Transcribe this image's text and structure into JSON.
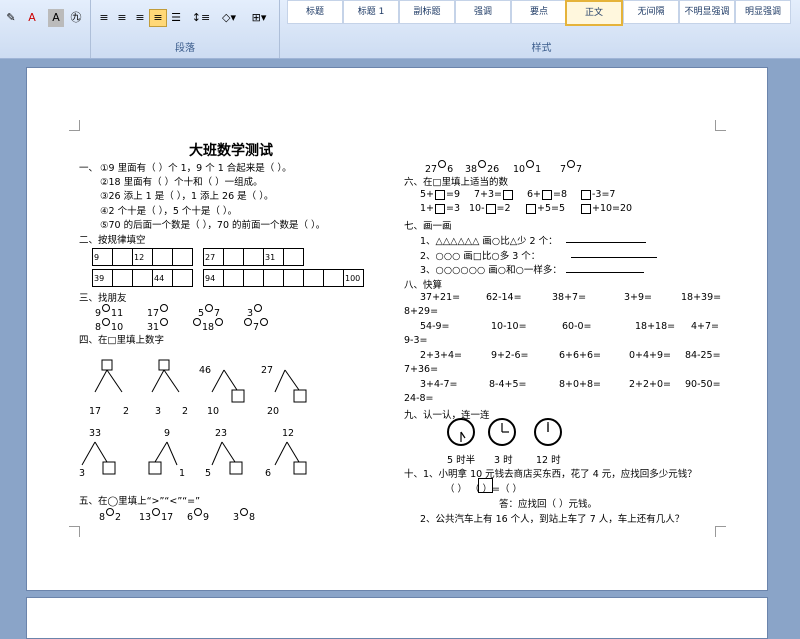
{
  "ribbon": {
    "paragraph_label": "段落",
    "styles_label": "样式",
    "styles": [
      "标题",
      "标题 1",
      "副标题",
      "强调",
      "要点",
      "正文",
      "无间隔",
      "不明显强调",
      "明显强调"
    ],
    "active_style": "正文"
  },
  "doc": {
    "title": "大班数学测试",
    "s1": {
      "head": "一、",
      "l1": "①9 里面有（    ）个 1，9 个 1 合起来是（    ）。",
      "l2": "②18 里面有（    ）个十和（    ）一组成。",
      "l3": "③26 添上 1 是（    ），1 添上 26 是（    ）。",
      "l4": "④2 个十是（    ），5 个十是（    ）。",
      "l5": "⑤70 的后面一个数是（    ），70 的前面一个数是（    ）。"
    },
    "s2": {
      "head": "二、按规律填空",
      "row1": [
        "9",
        "",
        "12",
        "",
        "",
        "27",
        "",
        "",
        "31",
        ""
      ],
      "row2": [
        "39",
        "",
        "",
        "44",
        "",
        "94",
        "",
        "",
        "",
        "",
        "",
        "",
        "100"
      ]
    },
    "s3": {
      "head": "三、找朋友",
      "r1": [
        "9",
        "11",
        "17",
        "5",
        "7",
        "3"
      ],
      "r2": [
        "8",
        "10",
        "31",
        "18",
        "7"
      ]
    },
    "s4": {
      "head": "四、在□里填上数字",
      "tops": [
        "46",
        "27"
      ],
      "bottoms": [
        "17",
        "2",
        "3",
        "2",
        "10",
        "20"
      ],
      "tops2": [
        "33",
        "9",
        "23",
        "12"
      ],
      "bottoms2": [
        "3",
        "1",
        "5",
        "6"
      ]
    },
    "s5": {
      "head": "五、在◯里填上“>”“<”“=”",
      "items": [
        "8",
        "2",
        "13",
        "17",
        "6",
        "9",
        "3",
        "8"
      ]
    },
    "right": {
      "compare": [
        "27",
        "6",
        "38",
        "26",
        "10",
        "1",
        "7",
        "7"
      ],
      "s6_head": "六、在□里填上适当的数",
      "s6_r1": [
        "5+",
        "=9",
        "7+3=",
        "6+",
        "=8",
        "-3=7"
      ],
      "s6_r2": [
        "1+",
        "=3",
        "10-",
        "=2",
        "+5=5",
        "+10=20"
      ],
      "s7_head": "七、画一画",
      "s7_l1": "1、△△△△△△      画○比△少 2 个：",
      "s7_l2": "2、○○○           画□比○多 3 个：",
      "s7_l3": "3、○○○○○○     画○和○一样多：",
      "s8_head": "八、快算",
      "calc": [
        [
          "37+21=",
          "62-14=",
          "38+7=",
          "3+9=",
          "18+39="
        ],
        [
          "8+29="
        ],
        [
          "54-9=",
          "10-10=",
          "60-0=",
          "18+18=",
          "4+7="
        ],
        [
          "9-3="
        ],
        [
          "2+3+4=",
          "9+2-6=",
          "6+6+6=",
          "0+4+9=",
          "84-25="
        ],
        [
          "7+36="
        ],
        [
          "3+4-7=",
          "8-4+5=",
          "8+0+8=",
          "2+2+0=",
          "90-50="
        ],
        [
          "24-8="
        ]
      ],
      "s9_head": "九、认一认，连一连",
      "clocks": [
        "5 时半",
        "3 时",
        "12 时"
      ],
      "s10_head": "十、1、小明拿 10 元钱去商店买东西，花了 4 元，应找回多少元钱？",
      "s10_eq": "（    ）    （    ）=（    ）",
      "s10_ans": "答：应找回（    ）元钱。",
      "s10_q2": "2、公共汽车上有 16 个人，到站上车了 7 人，车上还有几人？"
    }
  }
}
